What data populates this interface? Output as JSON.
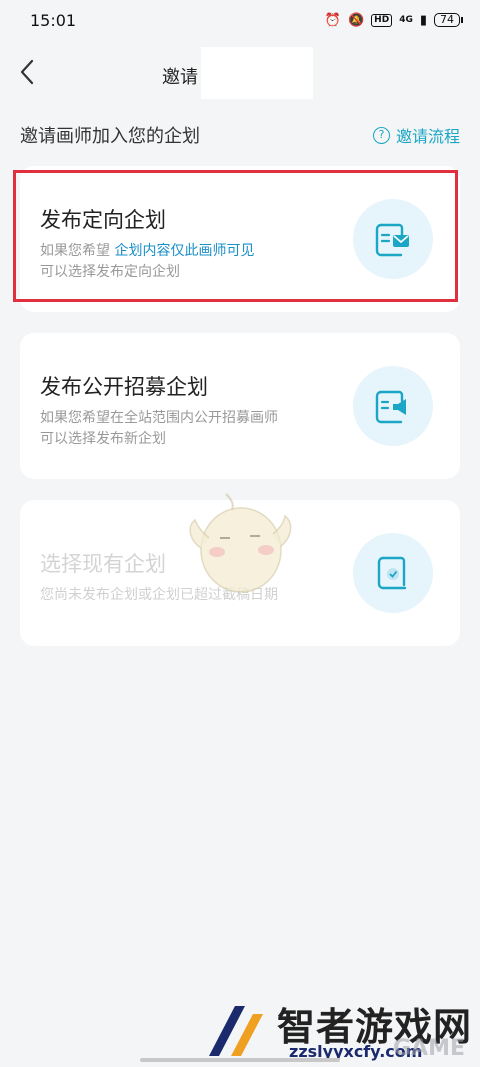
{
  "status": {
    "time": "15:01",
    "hd": "HD",
    "network": "4G",
    "battery": "74"
  },
  "nav": {
    "back_icon": "chevron-left-icon",
    "title": "邀请"
  },
  "section": {
    "title": "邀请画师加入您的企划",
    "flow_link": "邀请流程",
    "help_icon": "question-circle-icon"
  },
  "cards": [
    {
      "title": "发布定向企划",
      "desc_prefix": "如果您希望",
      "desc_highlight": "企划内容仅此画师可见",
      "desc2": "可以选择发布定向企划",
      "icon": "document-mail-icon",
      "enabled": true
    },
    {
      "title": "发布公开招募企划",
      "desc1": "如果您希望在全站范围内公开招募画师",
      "desc2": "可以选择发布新企划",
      "icon": "document-megaphone-icon",
      "enabled": true
    },
    {
      "title": "选择现有企划",
      "desc1": "您尚未发布企划或企划已超过截稿日期",
      "icon": "document-check-icon",
      "enabled": false
    }
  ],
  "colors": {
    "accent": "#1aa6c4",
    "highlight_frame": "#e0303f",
    "background": "#f4f5f7"
  },
  "watermark": {
    "text": "智者游戏网",
    "url": "zzslyyxcfy.com",
    "ghost": "GAME"
  }
}
